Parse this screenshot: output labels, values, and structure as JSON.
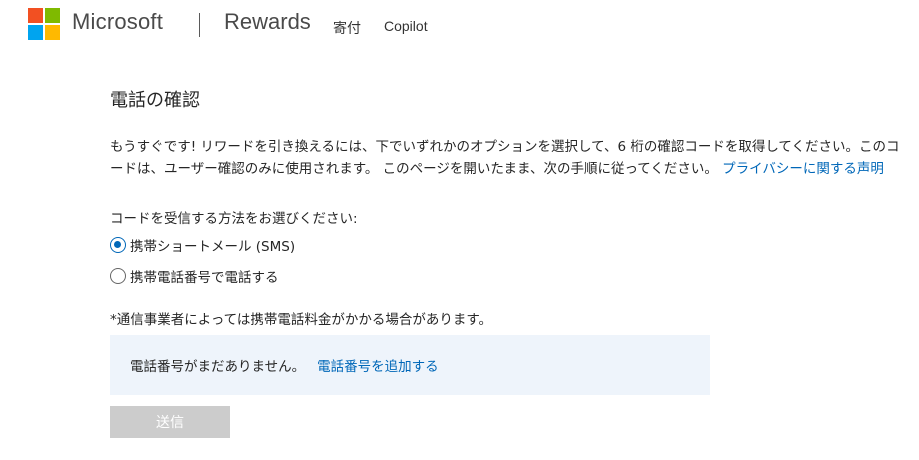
{
  "header": {
    "brand": "Microsoft",
    "separator": "|",
    "product": "Rewards",
    "nav": {
      "donate": "寄付",
      "copilot": "Copilot"
    }
  },
  "main": {
    "title": "電話の確認",
    "description": "もうすぐです! リワードを引き換えるには、下でいずれかのオプションを選択して、6 桁の確認コードを取得してください。このコードは、ユーザー確認のみに使用されます。 このページを開いたまま、次の手順に従ってください。",
    "privacy_link": "プライバシーに関する声明",
    "choose_label": "コードを受信する方法をお選びください:",
    "options": [
      {
        "label": "携帯ショートメール (SMS)",
        "selected": true
      },
      {
        "label": "携帯電話番号で電話する",
        "selected": false
      }
    ],
    "note": "*通信事業者によっては携帯電話料金がかかる場合があります。",
    "info": {
      "text": "電話番号がまだありません。",
      "link": "電話番号を追加する"
    },
    "submit_label": "送信"
  },
  "colors": {
    "accent": "#0067b8",
    "info_bg": "#eef4fb",
    "disabled_btn": "#cccccc"
  }
}
